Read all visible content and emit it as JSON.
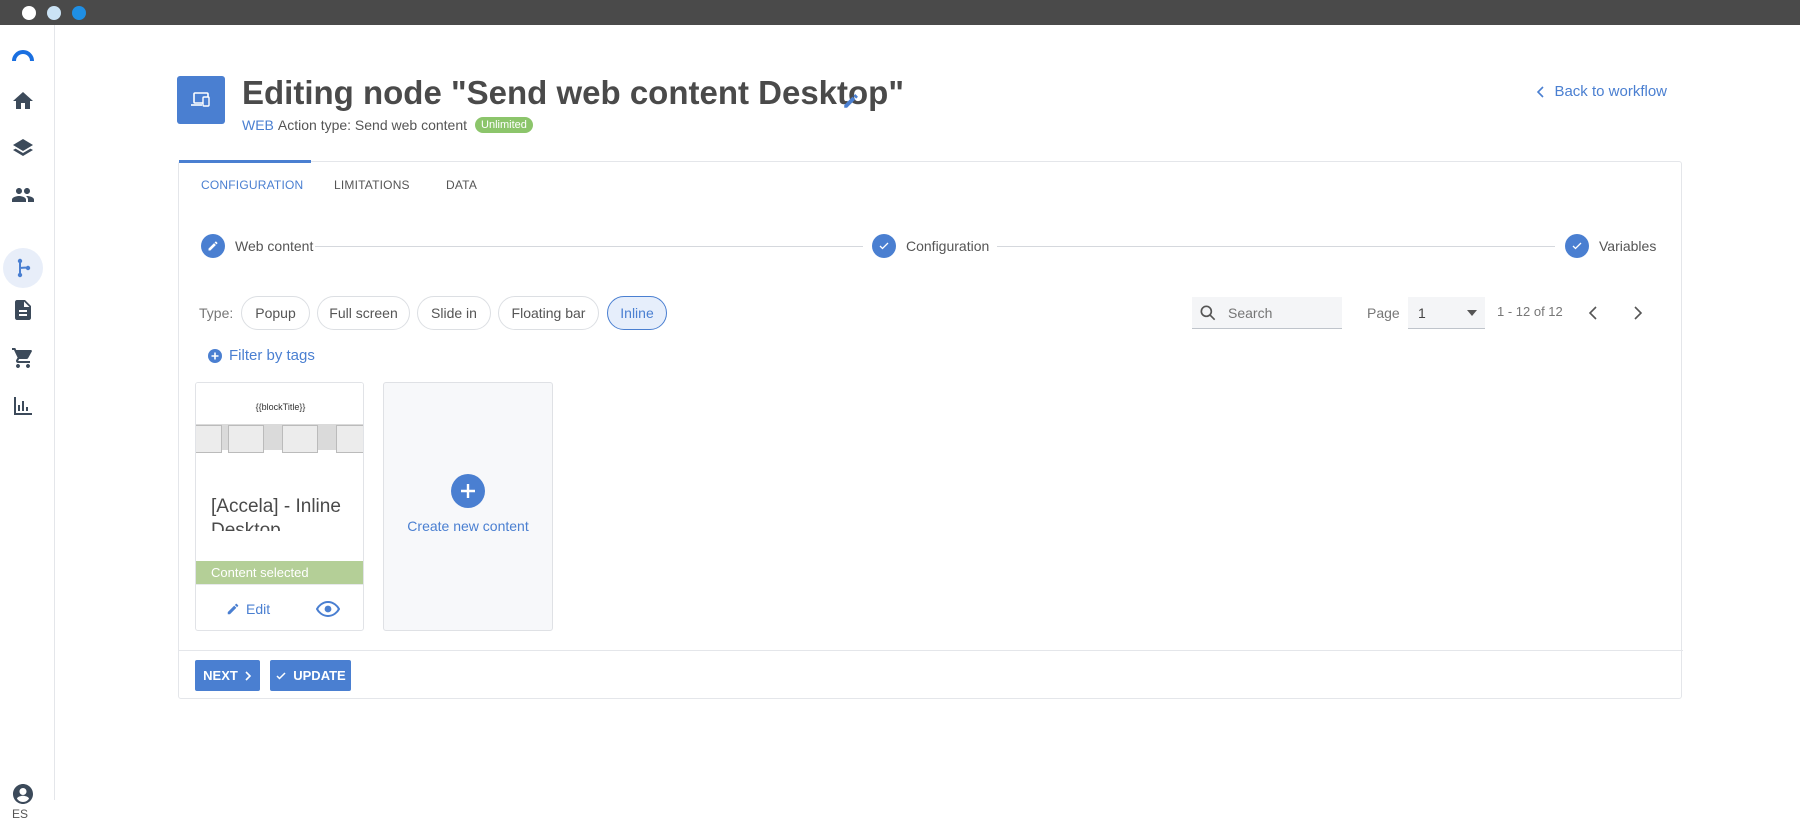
{
  "window": {
    "dots": [
      "#ffffff",
      "#cbe3f5",
      "#1f8fe5"
    ]
  },
  "sidebar": {
    "items": [
      {
        "icon": "logo-icon"
      },
      {
        "icon": "home-icon"
      },
      {
        "icon": "layers-icon"
      },
      {
        "icon": "people-icon"
      },
      {
        "icon": "workflow-icon",
        "active": true
      },
      {
        "icon": "document-icon"
      },
      {
        "icon": "cart-icon"
      },
      {
        "icon": "bar-chart-icon"
      },
      {
        "icon": "account-icon"
      }
    ],
    "language": "ES"
  },
  "header": {
    "title": "Editing node \"Send web content Desktop\"",
    "channel": "WEB",
    "action_type": "Action type: Send web content",
    "badge": "Unlimited",
    "back_label": "Back to workflow"
  },
  "tabs": [
    {
      "label": "CONFIGURATION",
      "active": true
    },
    {
      "label": "LIMITATIONS"
    },
    {
      "label": "DATA"
    }
  ],
  "steps": [
    {
      "label": "Web content",
      "icon": "pencil-icon"
    },
    {
      "label": "Configuration",
      "icon": "check-icon"
    },
    {
      "label": "Variables",
      "icon": "check-icon"
    }
  ],
  "filters": {
    "type_label": "Type:",
    "types": [
      {
        "label": "Popup"
      },
      {
        "label": "Full screen"
      },
      {
        "label": "Slide in"
      },
      {
        "label": "Floating bar"
      },
      {
        "label": "Inline",
        "active": true
      }
    ],
    "search_placeholder": "Search",
    "page_label": "Page",
    "page_value": "1",
    "range": "1 - 12 of 12",
    "filter_by_tags": "Filter by tags"
  },
  "contents": [
    {
      "thumb_title": "{{blockTitle}}",
      "name": "[Accela] - Inline Desktop",
      "status": "Content selected",
      "edit_label": "Edit"
    }
  ],
  "create_label": "Create new content",
  "footer": {
    "next_label": "NEXT",
    "update_label": "UPDATE"
  },
  "colors": {
    "accent": "#4a7fd1",
    "badge": "#8cc56b",
    "selected": "#b4cf97"
  }
}
